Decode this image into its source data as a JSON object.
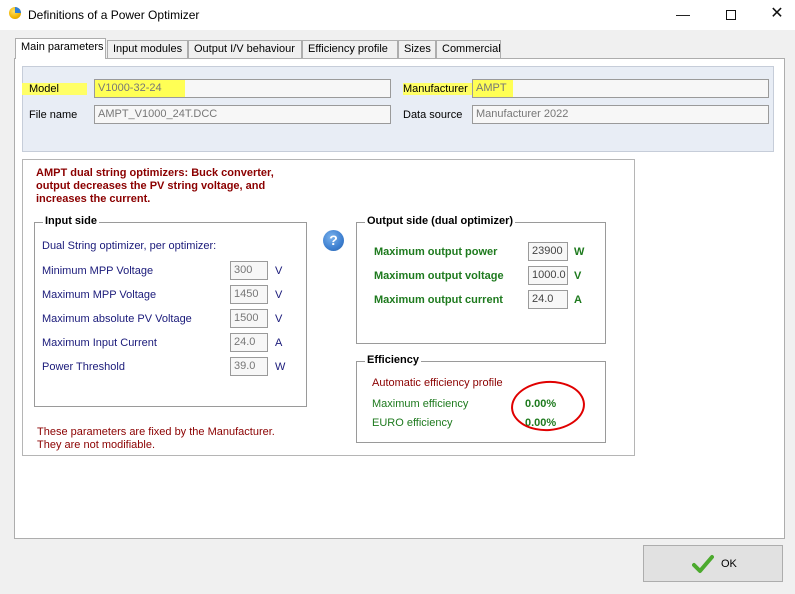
{
  "window": {
    "title": "Definitions of a Power Optimizer",
    "minimize": "—",
    "close": "✕"
  },
  "tabs": [
    {
      "label": "Main parameters",
      "active": true
    },
    {
      "label": "Input modules"
    },
    {
      "label": "Output I/V behaviour"
    },
    {
      "label": "Efficiency profile"
    },
    {
      "label": "Sizes"
    },
    {
      "label": "Commercial"
    }
  ],
  "header": {
    "model_label": "Model",
    "model_value": "V1000-32-24",
    "manufacturer_label": "Manufacturer",
    "manufacturer_value": "AMPT",
    "file_name_label": "File name",
    "file_name_value": "AMPT_V1000_24T.DCC",
    "data_source_label": "Data source",
    "data_source_value": "Manufacturer 2022"
  },
  "description": "AMPT dual string optimizers: Buck converter, output decreases the PV string voltage, and increases the current.",
  "input_side": {
    "title": "Input side",
    "subtitle": "Dual String optimizer, per optimizer:",
    "rows": [
      {
        "label": "Minimum MPP Voltage",
        "value": "300",
        "unit": "V"
      },
      {
        "label": "Maximum MPP Voltage",
        "value": "1450",
        "unit": "V"
      },
      {
        "label": "Maximum absolute PV Voltage",
        "value": "1500",
        "unit": "V"
      },
      {
        "label": "Maximum Input Current",
        "value": "24.0",
        "unit": "A"
      },
      {
        "label": "Power Threshold",
        "value": "39.0",
        "unit": "W"
      }
    ]
  },
  "help_icon": "?",
  "output_side": {
    "title": "Output side (dual optimizer)",
    "rows": [
      {
        "label": "Maximum output power",
        "value": "23900",
        "unit": "W"
      },
      {
        "label": "Maximum output voltage",
        "value": "1000.0",
        "unit": "V"
      },
      {
        "label": "Maximum output current",
        "value": "24.0",
        "unit": "A"
      }
    ]
  },
  "efficiency": {
    "title": "Efficiency",
    "profile_label": "Automatic efficiency profile",
    "max_label": "Maximum efficiency",
    "max_value": "0.00%",
    "euro_label": "EURO efficiency",
    "euro_value": "0.00%"
  },
  "fixed_note": {
    "line1": "These parameters are fixed by the Manufacturer.",
    "line2": "They are not modifiable."
  },
  "ok_button": {
    "label": "OK"
  },
  "colors": {
    "highlight": "#ffff66",
    "annotation_circle": "#e00000",
    "dark_red_text": "#8b0000",
    "green_text": "#1e7a1e",
    "navy_text": "#1a1a7a"
  }
}
